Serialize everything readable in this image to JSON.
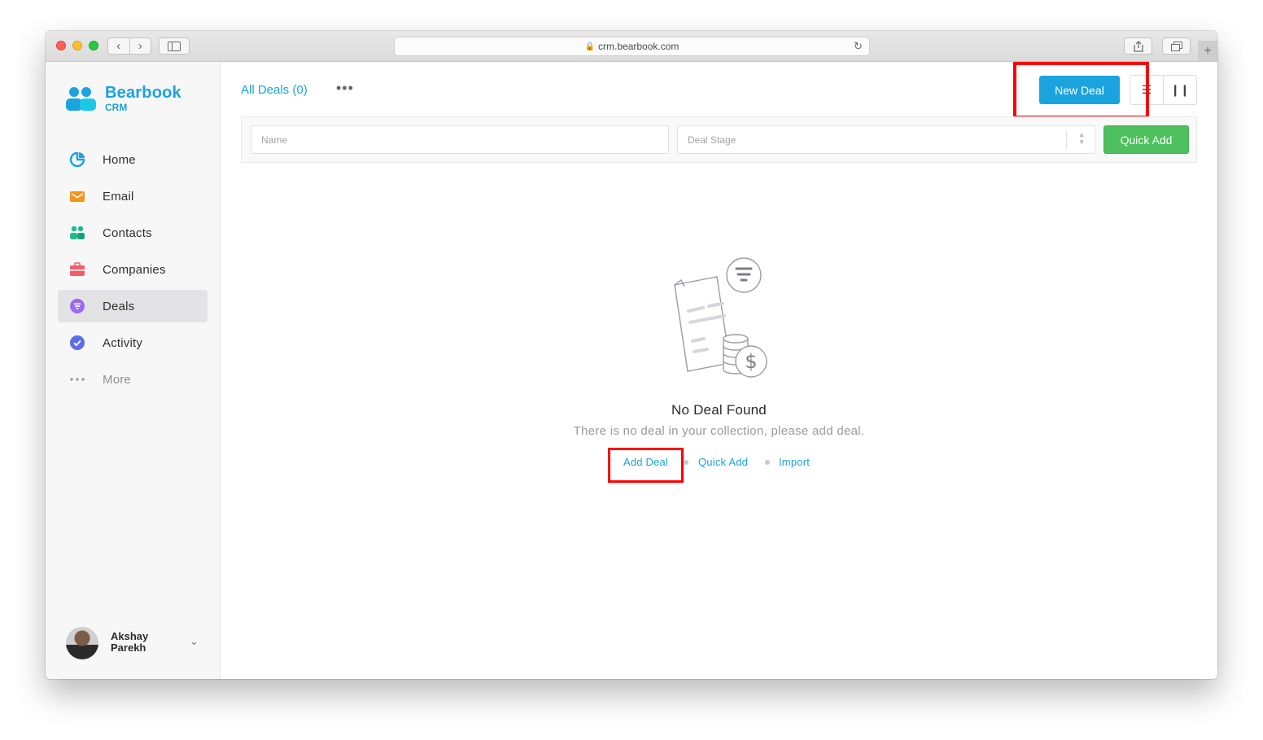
{
  "browser": {
    "url": "crm.bearbook.com",
    "back_icon": "chevron-left-icon",
    "forward_icon": "chevron-right-icon",
    "new_tab_label": "+"
  },
  "app": {
    "brand": "Bearbook",
    "brand_sub": "CRM",
    "colors": {
      "accent": "#1aa3de",
      "success": "#4dbf5c",
      "highlight": "#ff0000"
    }
  },
  "sidebar": {
    "items": [
      {
        "label": "Home",
        "icon": "pie-chart-icon"
      },
      {
        "label": "Email",
        "icon": "envelope-icon"
      },
      {
        "label": "Contacts",
        "icon": "users-icon"
      },
      {
        "label": "Companies",
        "icon": "briefcase-icon"
      },
      {
        "label": "Deals",
        "icon": "filter-circle-icon",
        "active": true
      },
      {
        "label": "Activity",
        "icon": "check-circle-icon"
      },
      {
        "label": "More",
        "icon": "ellipsis-icon"
      }
    ],
    "user": {
      "name": "Akshay Parekh"
    }
  },
  "header": {
    "title": "All Deals (0)",
    "more_label": "•••",
    "new_deal_label": "New Deal"
  },
  "filters": {
    "name_placeholder": "Name",
    "stage_placeholder": "Deal Stage",
    "quick_add_label": "Quick Add"
  },
  "empty_state": {
    "title": "No Deal Found",
    "subtitle": "There is no deal in your collection, please add deal.",
    "actions": {
      "add": "Add Deal",
      "quick_add": "Quick Add",
      "import": "Import"
    }
  }
}
